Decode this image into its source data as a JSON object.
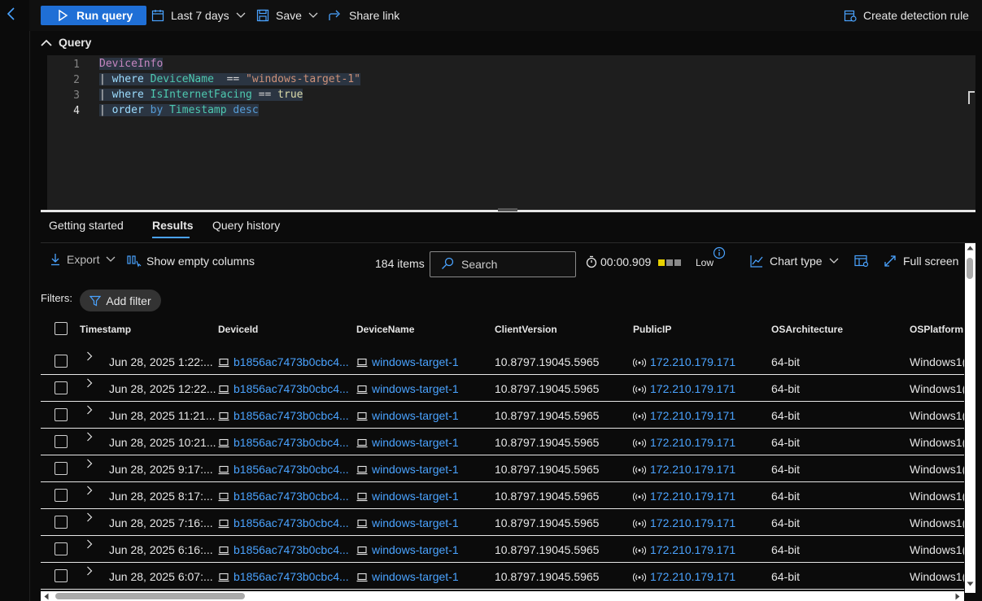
{
  "toolbar": {
    "run_label": "Run query",
    "time_range": "Last 7 days",
    "save_label": "Save",
    "share_label": "Share link",
    "create_rule_label": "Create detection rule"
  },
  "query": {
    "header": "Query",
    "lines": [
      {
        "n": "1"
      },
      {
        "n": "2"
      },
      {
        "n": "3"
      },
      {
        "n": "4"
      }
    ],
    "tokens": {
      "table": "DeviceInfo",
      "pipe": "|",
      "where": "where",
      "col_devicename": "DeviceName",
      "op_eq": "==",
      "str_target": "\"windows-target-1\"",
      "col_internet": "IsInternetFacing",
      "bool_true": "true",
      "order": "order",
      "by": "by",
      "col_timestamp": "Timestamp",
      "desc": "desc"
    }
  },
  "tabs": [
    {
      "label": "Getting started"
    },
    {
      "label": "Results"
    },
    {
      "label": "Query history"
    }
  ],
  "results": {
    "export_label": "Export",
    "show_empty_label": "Show empty columns",
    "items_count": "184 items",
    "search_placeholder": "Search",
    "elapsed": "00:00.909",
    "perf_label": "Low",
    "chart_type_label": "Chart type",
    "full_screen_label": "Full screen",
    "filters_label": "Filters:",
    "add_filter_label": "Add filter"
  },
  "table": {
    "columns": [
      "Timestamp",
      "DeviceId",
      "DeviceName",
      "ClientVersion",
      "PublicIP",
      "OSArchitecture",
      "OSPlatform"
    ],
    "rows": [
      {
        "timestamp": "Jun 28, 2025 1:22:...",
        "device_id": "b1856ac7473b0cbc4...",
        "device_name": "windows-target-1",
        "client_version": "10.8797.19045.5965",
        "public_ip": "172.210.179.171",
        "arch": "64-bit",
        "platform": "Windows1("
      },
      {
        "timestamp": "Jun 28, 2025 12:22...",
        "device_id": "b1856ac7473b0cbc4...",
        "device_name": "windows-target-1",
        "client_version": "10.8797.19045.5965",
        "public_ip": "172.210.179.171",
        "arch": "64-bit",
        "platform": "Windows1("
      },
      {
        "timestamp": "Jun 28, 2025 11:21...",
        "device_id": "b1856ac7473b0cbc4...",
        "device_name": "windows-target-1",
        "client_version": "10.8797.19045.5965",
        "public_ip": "172.210.179.171",
        "arch": "64-bit",
        "platform": "Windows1("
      },
      {
        "timestamp": "Jun 28, 2025 10:21...",
        "device_id": "b1856ac7473b0cbc4...",
        "device_name": "windows-target-1",
        "client_version": "10.8797.19045.5965",
        "public_ip": "172.210.179.171",
        "arch": "64-bit",
        "platform": "Windows1("
      },
      {
        "timestamp": "Jun 28, 2025 9:17:...",
        "device_id": "b1856ac7473b0cbc4...",
        "device_name": "windows-target-1",
        "client_version": "10.8797.19045.5965",
        "public_ip": "172.210.179.171",
        "arch": "64-bit",
        "platform": "Windows1("
      },
      {
        "timestamp": "Jun 28, 2025 8:17:...",
        "device_id": "b1856ac7473b0cbc4...",
        "device_name": "windows-target-1",
        "client_version": "10.8797.19045.5965",
        "public_ip": "172.210.179.171",
        "arch": "64-bit",
        "platform": "Windows1("
      },
      {
        "timestamp": "Jun 28, 2025 7:16:...",
        "device_id": "b1856ac7473b0cbc4...",
        "device_name": "windows-target-1",
        "client_version": "10.8797.19045.5965",
        "public_ip": "172.210.179.171",
        "arch": "64-bit",
        "platform": "Windows1("
      },
      {
        "timestamp": "Jun 28, 2025 6:16:...",
        "device_id": "b1856ac7473b0cbc4...",
        "device_name": "windows-target-1",
        "client_version": "10.8797.19045.5965",
        "public_ip": "172.210.179.171",
        "arch": "64-bit",
        "platform": "Windows1("
      },
      {
        "timestamp": "Jun 28, 2025 6:07:...",
        "device_id": "b1856ac7473b0cbc4...",
        "device_name": "windows-target-1",
        "client_version": "10.8797.19045.5965",
        "public_ip": "172.210.179.171",
        "arch": "64-bit",
        "platform": "Windows1("
      }
    ]
  },
  "icons": {
    "back": "chevron-left-icon",
    "run": "play-icon",
    "time": "calendar-icon",
    "save": "save-icon",
    "share": "share-icon",
    "create_rule": "detection-rule-icon",
    "export": "download-icon",
    "show_empty": "columns-icon",
    "search": "search-icon",
    "timer": "stopwatch-icon",
    "info": "info-icon",
    "chart": "chart-icon",
    "full_screen": "expand-icon",
    "add_filter": "filter-icon",
    "device": "laptop-icon",
    "ip": "signal-icon"
  },
  "colors": {
    "accent": "#1f6fd6",
    "link": "#4aa3ff",
    "perf_high": "#e8d200",
    "perf_low": "#8a8a8a"
  }
}
